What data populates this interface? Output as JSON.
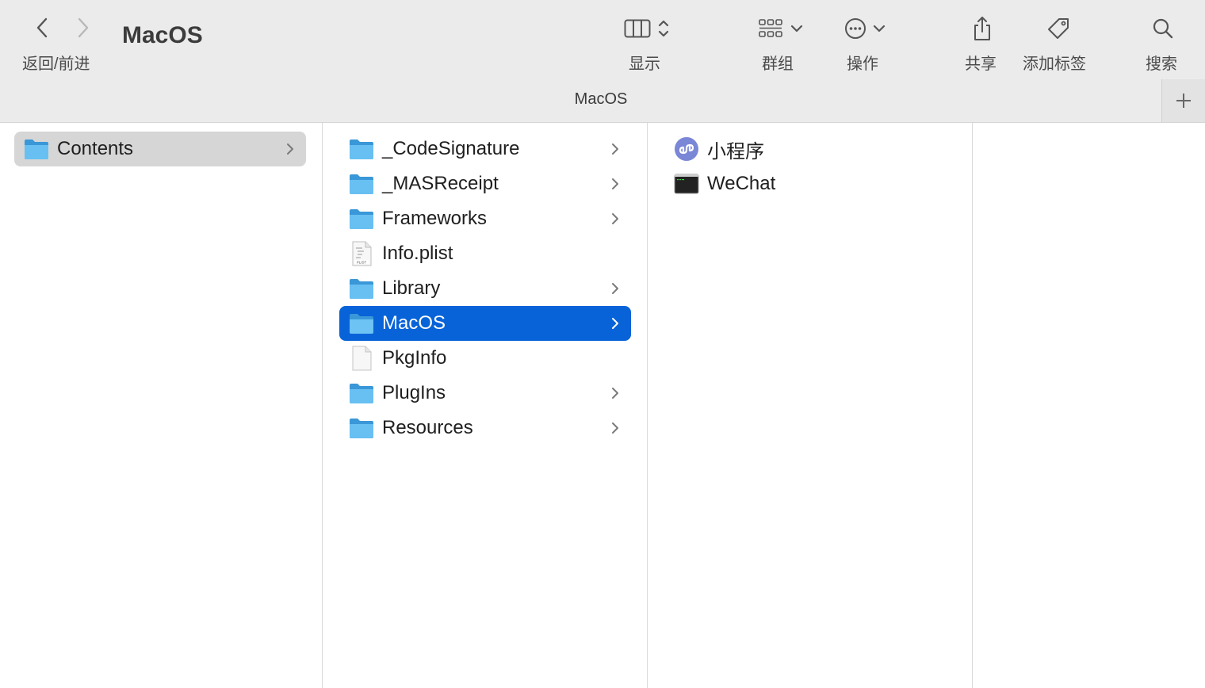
{
  "window": {
    "title": "MacOS"
  },
  "toolbar": {
    "nav_label": "返回/前进",
    "view_label": "显示",
    "group_label": "群组",
    "action_label": "操作",
    "share_label": "共享",
    "tag_label": "添加标签",
    "search_label": "搜索"
  },
  "pathbar": {
    "title": "MacOS"
  },
  "columns": [
    {
      "items": [
        {
          "name": "Contents",
          "icon": "folder-icon",
          "has_children": true,
          "state": "parent-selected"
        }
      ]
    },
    {
      "items": [
        {
          "name": "_CodeSignature",
          "icon": "folder-icon",
          "has_children": true
        },
        {
          "name": "_MASReceipt",
          "icon": "folder-icon",
          "has_children": true
        },
        {
          "name": "Frameworks",
          "icon": "folder-icon",
          "has_children": true
        },
        {
          "name": "Info.plist",
          "icon": "plist-file-icon",
          "has_children": false
        },
        {
          "name": "Library",
          "icon": "folder-icon",
          "has_children": true
        },
        {
          "name": "MacOS",
          "icon": "folder-icon",
          "has_children": true,
          "state": "selected"
        },
        {
          "name": "PkgInfo",
          "icon": "blank-file-icon",
          "has_children": false
        },
        {
          "name": "PlugIns",
          "icon": "folder-icon",
          "has_children": true
        },
        {
          "name": "Resources",
          "icon": "folder-icon",
          "has_children": true
        }
      ]
    },
    {
      "items": [
        {
          "name": "小程序",
          "icon": "mini-program-icon",
          "has_children": false
        },
        {
          "name": "WeChat",
          "icon": "executable-icon",
          "has_children": false
        }
      ]
    }
  ],
  "colors": {
    "selection": "#0863d8",
    "parent_selection": "#d6d6d6",
    "toolbar_bg": "#ebebeb",
    "folder": "#5ab4ec"
  }
}
